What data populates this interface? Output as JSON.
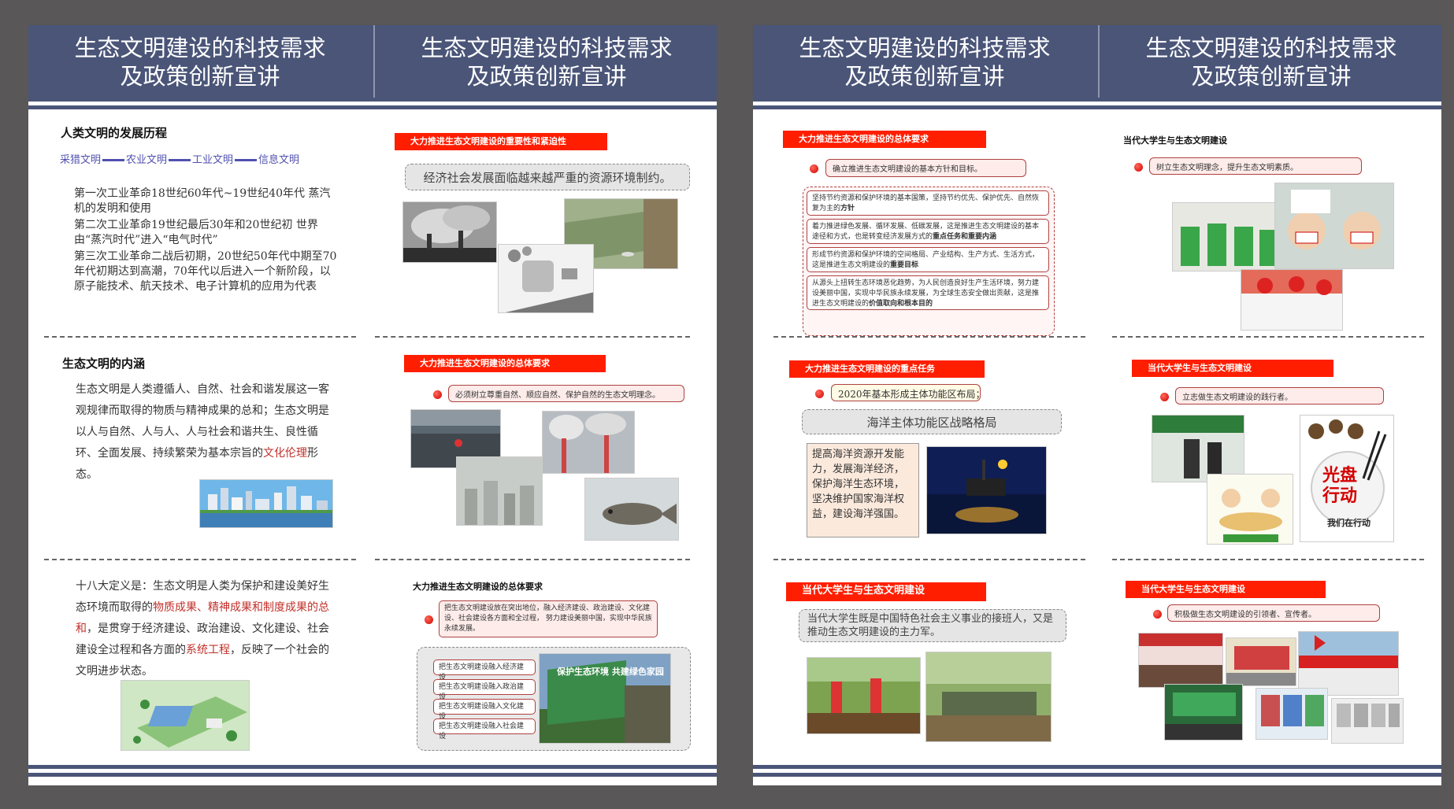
{
  "header": {
    "title_line1": "生态文明建设的科技需求",
    "title_line2": "及政策创新宣讲"
  },
  "p1": {
    "h_history": "人类文明的发展历程",
    "timeline": [
      "采猎文明",
      "农业文明",
      "工业文明",
      "信息文明"
    ],
    "rev1": "第一次工业革命18世纪60年代~19世纪40年代 蒸汽机的发明和使用",
    "rev2": "第二次工业革命19世纪最后30年和20世纪初 世界由“蒸汽时代”进入“电气时代”",
    "rev3": "第三次工业革命二战后初期，20世纪50年代中期至70年代初期达到高潮，70年代以后进入一个新阶段，以原子能技术、航天技术、电子计算机的应用为代表",
    "h_meaning": "生态文明的内涵",
    "meaning_a": "生态文明是人类遵循人、自然、社会和谐发展这一客观规律而取得的物质与精神成果的总和；生态文明是以人与自然、人与人、人与社会和谐共生、良性循环、全面发展、持续繁荣为基本宗旨的",
    "meaning_red": "文化伦理",
    "meaning_b": "形态。",
    "def_a": "十八大定义是：生态文明是人类为保护和建设美好生态环境而取得的",
    "def_red1": "物质成果、精神成果和制度成果的总和",
    "def_b": "，是贯穿于经济建设、政治建设、文化建设、社会建设全过程和各方面的",
    "def_red2": "系统工程",
    "def_c": "，反映了一个社会的文明进步状态。"
  },
  "p2": {
    "bar1": "大力推进生态文明建设的重要性和紧迫性",
    "grey1": "经济社会发展面临越来越严重的资源环境制约。",
    "bar2": "大力推进生态文明建设的总体要求",
    "pill2": "必须树立尊重自然、顺应自然、保护自然的生态文明理念。",
    "h3": "大力推进生态文明建设的总体要求",
    "box3": "把生态文明建设放在突出地位，融入经济建设、政治建设、文化建设、社会建设各方面和全过程， 努力建设美丽中国，实现中华民族永续发展。",
    "list3": [
      "把生态文明建设融入经济建设",
      "把生态文明建设融入政治建设",
      "把生态文明建设融入文化建设",
      "把生态文明建设融入社会建设"
    ],
    "billboard": "保护生态环境 共建绿色家园"
  },
  "p3": {
    "bar1": "大力推进生态文明建设的总体要求",
    "pill1": "确立推进生态文明建设的基本方针和目标。",
    "b1a": "坚持节约资源和保护环境的基本国策，坚持节约优先、保护优先、自然恢复为主的",
    "b1bold": "方针",
    "b2a": "着力推进绿色发展、循环发展、低碳发展，这是推进生态文明建设的基本途径和方式，也是转变经济发展方式的",
    "b2bold": "重点任务和重要内涵",
    "b3a": "形成节约资源和保护环境的空间格局、产业结构、生产方式、生活方式，这是推进生态文明建设的",
    "b3bold": "重要目标",
    "b4a": "从源头上扭转生态环境恶化趋势，为人民创造良好生产生活环境，努力建设美丽中国，实现中华民族永续发展，为全球生态安全做出贡献，这是推进生态文明建设的",
    "b4bold": "价值取向和根本目的",
    "bar2": "大力推进生态文明建设的重点任务",
    "pill2": "2020年基本形成主体功能区布局；",
    "grey2": "海洋主体功能区战略格局",
    "ocean": "提高海洋资源开发能力，发展海洋经济，保护海洋生态环境，坚决维护国家海洋权益，建设海洋强国。",
    "bar3": "当代大学生与生态文明建设",
    "grey3": "当代大学生既是中国特色社会主义事业的接班人，又是推动生态文明建设的主力军。"
  },
  "p4": {
    "h1": "当代大学生与生态文明建设",
    "pill1": "树立生态文明理念，提升生态文明素质。",
    "bar2": "当代大学生与生态文明建设",
    "pill2": "立志做生态文明建设的践行者。",
    "poster1": "光盘",
    "poster2": "行动",
    "poster3": "我们在行动",
    "bar3": "当代大学生与生态文明建设",
    "pill3": "积极做生态文明建设的引领者、宣传者。"
  },
  "colors": {
    "header": "#4a5578",
    "accent": "#ff1e00",
    "red_text": "#c0302a"
  }
}
